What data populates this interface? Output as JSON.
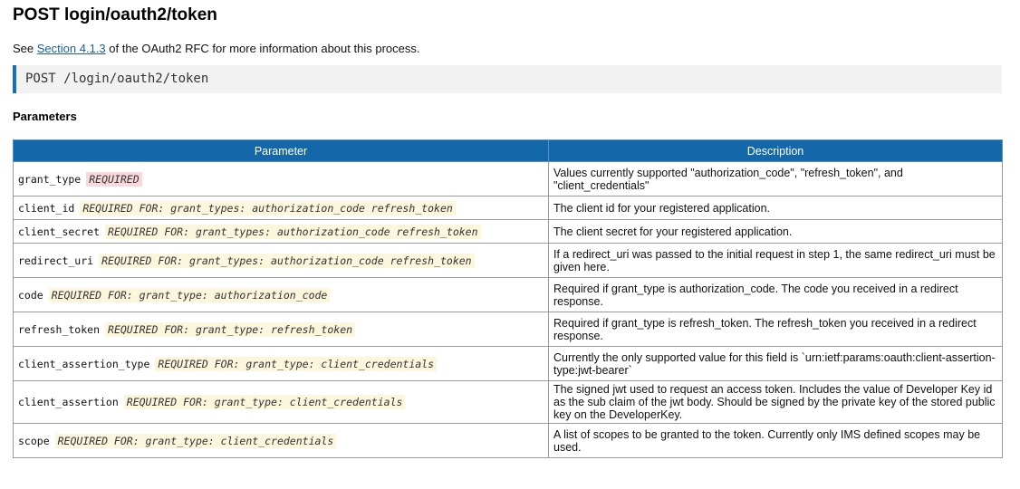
{
  "doc": {
    "title": "POST login/oauth2/token",
    "intro": {
      "before": "See ",
      "link": "Section 4.1.3",
      "after": " of the OAuth2 RFC for more information about this process."
    },
    "endpoint": "POST /login/oauth2/token",
    "parameters_heading": "Parameters"
  },
  "table": {
    "headers": {
      "parameter": "Parameter",
      "description": "Description"
    },
    "rows": [
      {
        "name": "grant_type",
        "requirement": "REQUIRED",
        "description": "Values currently supported \"authorization_code\", \"refresh_token\", and \"client_credentials\""
      },
      {
        "name": "client_id",
        "requirement": "REQUIRED FOR: grant_types: authorization_code refresh_token",
        "description": "The client id for your registered application."
      },
      {
        "name": "client_secret",
        "requirement": "REQUIRED FOR: grant_types: authorization_code refresh_token",
        "description": "The client secret for your registered application."
      },
      {
        "name": "redirect_uri",
        "requirement": "REQUIRED FOR: grant_types: authorization_code refresh_token",
        "description": "If a redirect_uri was passed to the initial request in step 1, the same redirect_uri must be given here."
      },
      {
        "name": "code",
        "requirement": "REQUIRED FOR: grant_type: authorization_code",
        "description": "Required if grant_type is authorization_code. The code you received in a redirect response."
      },
      {
        "name": "refresh_token",
        "requirement": "REQUIRED FOR: grant_type: refresh_token",
        "description": "Required if grant_type is refresh_token. The refresh_token you received in a redirect response."
      },
      {
        "name": "client_assertion_type",
        "requirement": "REQUIRED FOR: grant_type: client_credentials",
        "description": "Currently the only supported value for this field is `urn:ietf:params:oauth:client-assertion-type:jwt-bearer`"
      },
      {
        "name": "client_assertion",
        "requirement": "REQUIRED FOR: grant_type: client_credentials",
        "description": "The signed jwt used to request an access token. Includes the value of Developer Key id as the sub claim of the jwt body. Should be signed by the private key of the stored public key on the DeveloperKey."
      },
      {
        "name": "scope",
        "requirement": "REQUIRED FOR: grant_type: client_credentials",
        "description": "A list of scopes to be granted to the token. Currently only IMS defined scopes may be used."
      }
    ]
  },
  "colors": {
    "header_bg": "#1467a8",
    "endpoint_accent": "#1a6fb4",
    "link": "#1a5ea8",
    "required_badge_bg": "#f9d9db",
    "required_for_bg": "#fbf6dc"
  }
}
